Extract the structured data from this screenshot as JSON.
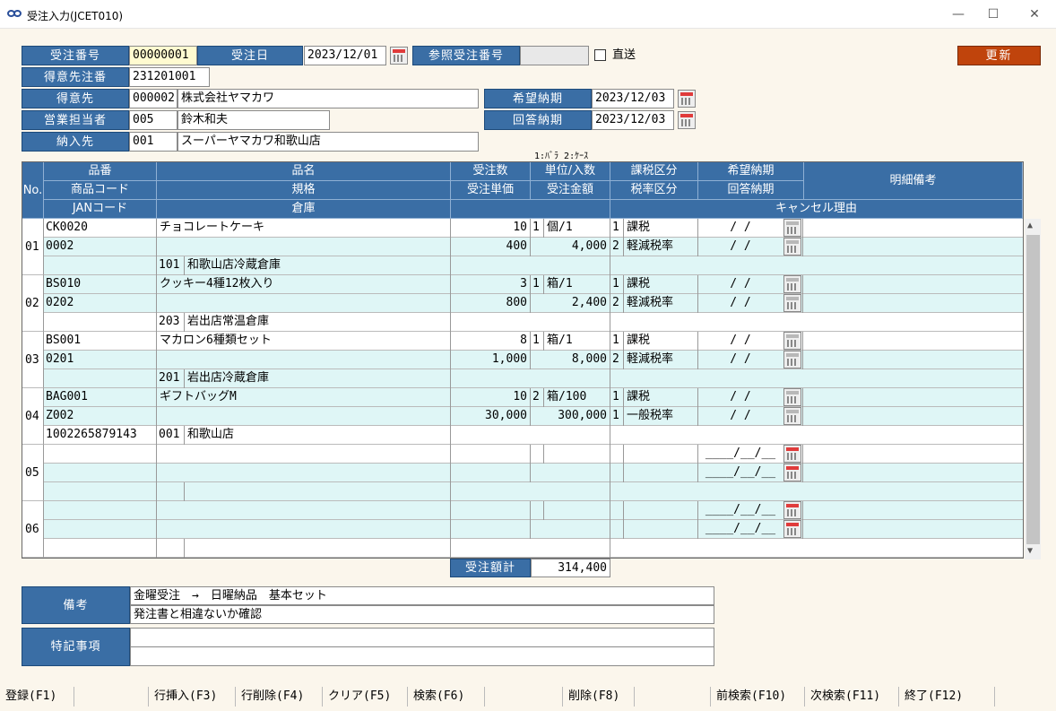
{
  "window": {
    "title": "受注入力(JCET010)",
    "min": "—",
    "max": "☐",
    "close": "✕"
  },
  "header": {
    "order_no_label": "受注番号",
    "order_no": "00000001",
    "order_date_label": "受注日",
    "order_date": "2023/12/01",
    "ref_order_label": "参照受注番号",
    "ref_order": "",
    "direct_label": "直送",
    "update_button": "更新",
    "customer_no_label": "得意先注番",
    "customer_no": "231201001",
    "customer_label": "得意先",
    "customer_code": "000002",
    "customer_name": "株式会社ヤマカワ",
    "sales_label": "営業担当者",
    "sales_code": "005",
    "sales_name": "鈴木和夫",
    "delivery_label": "納入先",
    "delivery_code": "001",
    "delivery_name": "スーパーヤマカワ和歌山店",
    "desired_label": "希望納期",
    "desired_date": "2023/12/03",
    "reply_label": "回答納期",
    "reply_date": "2023/12/03",
    "unit_note": "1:ﾊﾞﾗ 2:ｹｰｽ"
  },
  "grid_header": {
    "no": "No.",
    "item_no": "品番",
    "product_code": "商品コード",
    "jan": "JANコード",
    "item_name": "品名",
    "spec": "規格",
    "warehouse": "倉庫",
    "qty": "受注数",
    "unit_price": "受注単価",
    "unit_pack": "単位/入数",
    "amount": "受注金額",
    "tax_class": "課税区分",
    "tax_rate": "税率区分",
    "desired": "希望納期",
    "reply": "回答納期",
    "remarks": "明細備考",
    "cancel": "キャンセル理由"
  },
  "rows": [
    {
      "no": "01",
      "item_no": "CK0020",
      "product_code": "0002",
      "jan": "",
      "name": "チョコレートケーキ",
      "wh_code": "101",
      "wh_name": "和歌山店冷蔵倉庫",
      "qty": "10",
      "unit_type": "1",
      "unit": "個/1",
      "price": "400",
      "amount": "4,000",
      "tax_c": "1",
      "tax_c_name": "課税",
      "tax_r": "2",
      "tax_r_name": "軽減税率",
      "desired": "/  /",
      "reply": "/  /"
    },
    {
      "no": "02",
      "item_no": "BS010",
      "product_code": "0202",
      "jan": "",
      "name": "クッキー4種12枚入り",
      "wh_code": "203",
      "wh_name": "岩出店常温倉庫",
      "qty": "3",
      "unit_type": "1",
      "unit": "箱/1",
      "price": "800",
      "amount": "2,400",
      "tax_c": "1",
      "tax_c_name": "課税",
      "tax_r": "2",
      "tax_r_name": "軽減税率",
      "desired": "/  /",
      "reply": "/  /"
    },
    {
      "no": "03",
      "item_no": "BS001",
      "product_code": "0201",
      "jan": "",
      "name": "マカロン6種類セット",
      "wh_code": "201",
      "wh_name": "岩出店冷蔵倉庫",
      "qty": "8",
      "unit_type": "1",
      "unit": "箱/1",
      "price": "1,000",
      "amount": "8,000",
      "tax_c": "1",
      "tax_c_name": "課税",
      "tax_r": "2",
      "tax_r_name": "軽減税率",
      "desired": "/  /",
      "reply": "/  /"
    },
    {
      "no": "04",
      "item_no": "BAG001",
      "product_code": "Z002",
      "jan": "1002265879143",
      "name": "ギフトバッグM",
      "wh_code": "001",
      "wh_name": "和歌山店",
      "qty": "10",
      "unit_type": "2",
      "unit": "箱/100",
      "price": "30,000",
      "amount": "300,000",
      "tax_c": "1",
      "tax_c_name": "課税",
      "tax_r": "1",
      "tax_r_name": "一般税率",
      "desired": "/  /",
      "reply": "/  /"
    },
    {
      "no": "05",
      "item_no": "",
      "product_code": "",
      "jan": "",
      "name": "",
      "wh_code": "",
      "wh_name": "",
      "qty": "",
      "unit_type": "",
      "unit": "",
      "price": "",
      "amount": "",
      "tax_c": "",
      "tax_c_name": "",
      "tax_r": "",
      "tax_r_name": "",
      "desired": "____/__/__",
      "reply": "____/__/__"
    },
    {
      "no": "06",
      "item_no": "",
      "product_code": "",
      "jan": "",
      "name": "",
      "wh_code": "",
      "wh_name": "",
      "qty": "",
      "unit_type": "",
      "unit": "",
      "price": "",
      "amount": "",
      "tax_c": "",
      "tax_c_name": "",
      "tax_r": "",
      "tax_r_name": "",
      "desired": "____/__/__",
      "reply": "____/__/__"
    }
  ],
  "total": {
    "label": "受注額計",
    "value": "314,400"
  },
  "notes": {
    "label": "備考",
    "line1": "金曜受注　→　日曜納品　基本セット",
    "line2": "発注書と相違ないか確認"
  },
  "special": {
    "label": "特記事項",
    "line1": "",
    "line2": ""
  },
  "fkeys": [
    "登録(F1)",
    "",
    "行挿入(F3)",
    "行削除(F4)",
    "クリア(F5)",
    "検索(F6)",
    "",
    "削除(F8)",
    "",
    "前検索(F10)",
    "次検索(F11)",
    "終了(F12)"
  ]
}
